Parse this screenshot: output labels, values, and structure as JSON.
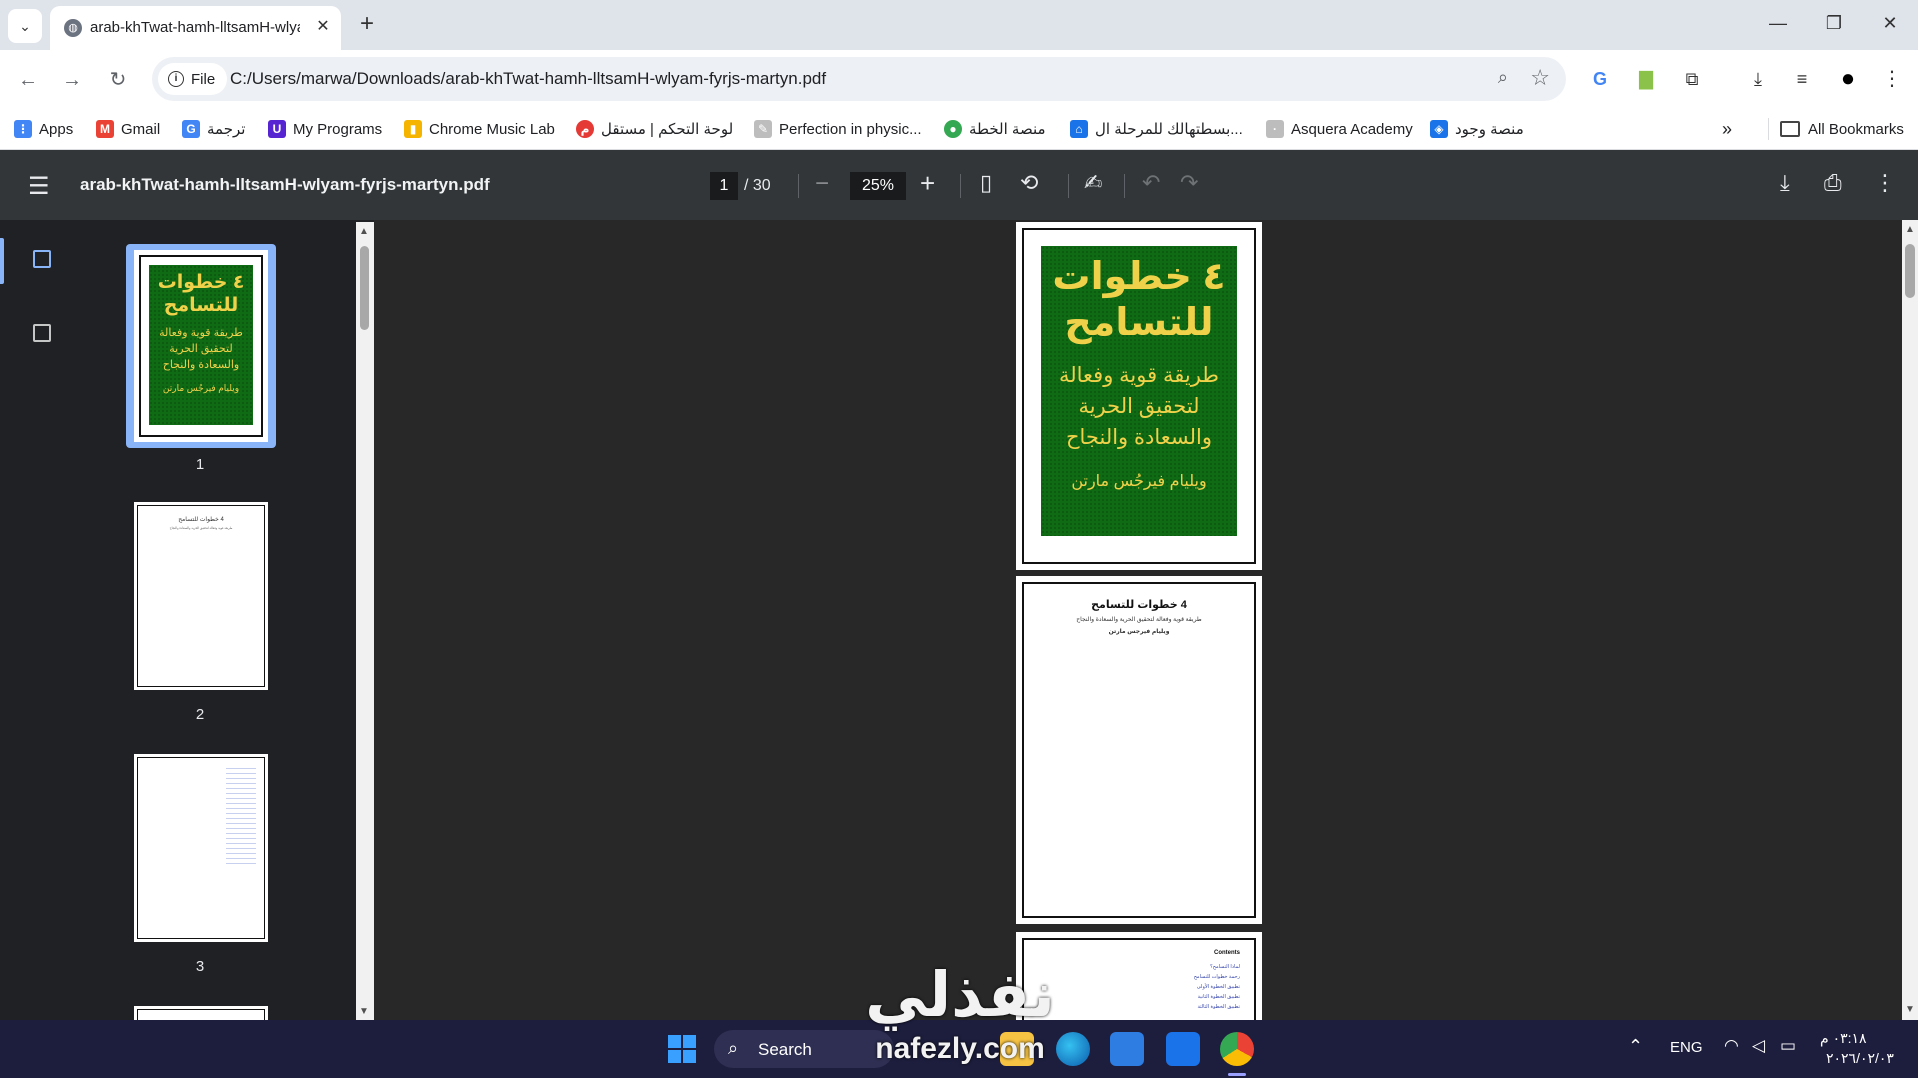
{
  "browser": {
    "tab_title": "arab-khTwat-hamh-lltsamH-wlyam-fyrjs-martyn.pdf",
    "file_chip": "File",
    "url": "C:/Users/marwa/Downloads/arab-khTwat-hamh-lltsamH-wlyam-fyrjs-martyn.pdf"
  },
  "bookmarks": [
    {
      "label": "Apps",
      "icon": "apps-grid-icon",
      "color": "#4285f4"
    },
    {
      "label": "Gmail",
      "icon": "gmail-icon",
      "color": "#ea4335"
    },
    {
      "label": "ترجمة",
      "icon": "translate-icon",
      "color": "#4285f4"
    },
    {
      "label": "My Programs",
      "icon": "udemy-icon",
      "color": "#5624d0"
    },
    {
      "label": "Chrome Music Lab",
      "icon": "music-lab-icon",
      "color": "#f4b400"
    },
    {
      "label": "لوحة التحكم | مستقل",
      "icon": "mostaql-icon",
      "color": "#e53935"
    },
    {
      "label": "Perfection in physic...",
      "icon": "pen-icon",
      "color": "#9e9e9e"
    },
    {
      "label": "منصة الخطة",
      "icon": "platform-icon",
      "color": "#34a853"
    },
    {
      "label": "بسطتهالك للمرحلة ال...",
      "icon": "school-icon",
      "color": "#1a73e8"
    },
    {
      "label": "Asquera Academy",
      "icon": "academy-icon",
      "color": "#9e9e9e"
    },
    {
      "label": "منصة وجود",
      "icon": "wojood-icon",
      "color": "#1a73e8"
    }
  ],
  "all_bookmarks": "All Bookmarks",
  "pdf": {
    "title": "arab-khTwat-hamh-lltsamH-wlyam-fyrjs-martyn.pdf",
    "current_page": "1",
    "total_pages": "/ 30",
    "zoom": "25%",
    "thumb_labels": [
      "1",
      "2",
      "3"
    ]
  },
  "cover": {
    "title_line1": "٤ خطوات",
    "title_line2": "للتسامح",
    "subtitle_line1": "طريقة قوية وفعالة",
    "subtitle_line2": "لتحقيق الحرية",
    "subtitle_line3": "والسعادة والنجاح",
    "author": "ويليام فيرجُس مارتن"
  },
  "page2": {
    "heading": "4 خطوات للتسامح",
    "subheading": "طريقة قوية وفعالة لتحقيق الحرية والسعادة والنجاح",
    "author": "ويليام فيرجس مارتن"
  },
  "page3": {
    "heading": "Contents",
    "items": [
      "لماذا التسامح؟",
      "رحمة خطوات للتسامح",
      "تطبيق الخطوة الأولى",
      "تطبيق الخطوة الثانية",
      "تطبيق الخطوة الثالثة"
    ]
  },
  "taskbar": {
    "search_label": "Search",
    "lang": "ENG",
    "time": "٠٣:١٨ م",
    "date": "٢٠٢٦/٠٢/٠٣"
  },
  "watermark": {
    "big": "نفذلي",
    "small": "nafezly.com"
  }
}
